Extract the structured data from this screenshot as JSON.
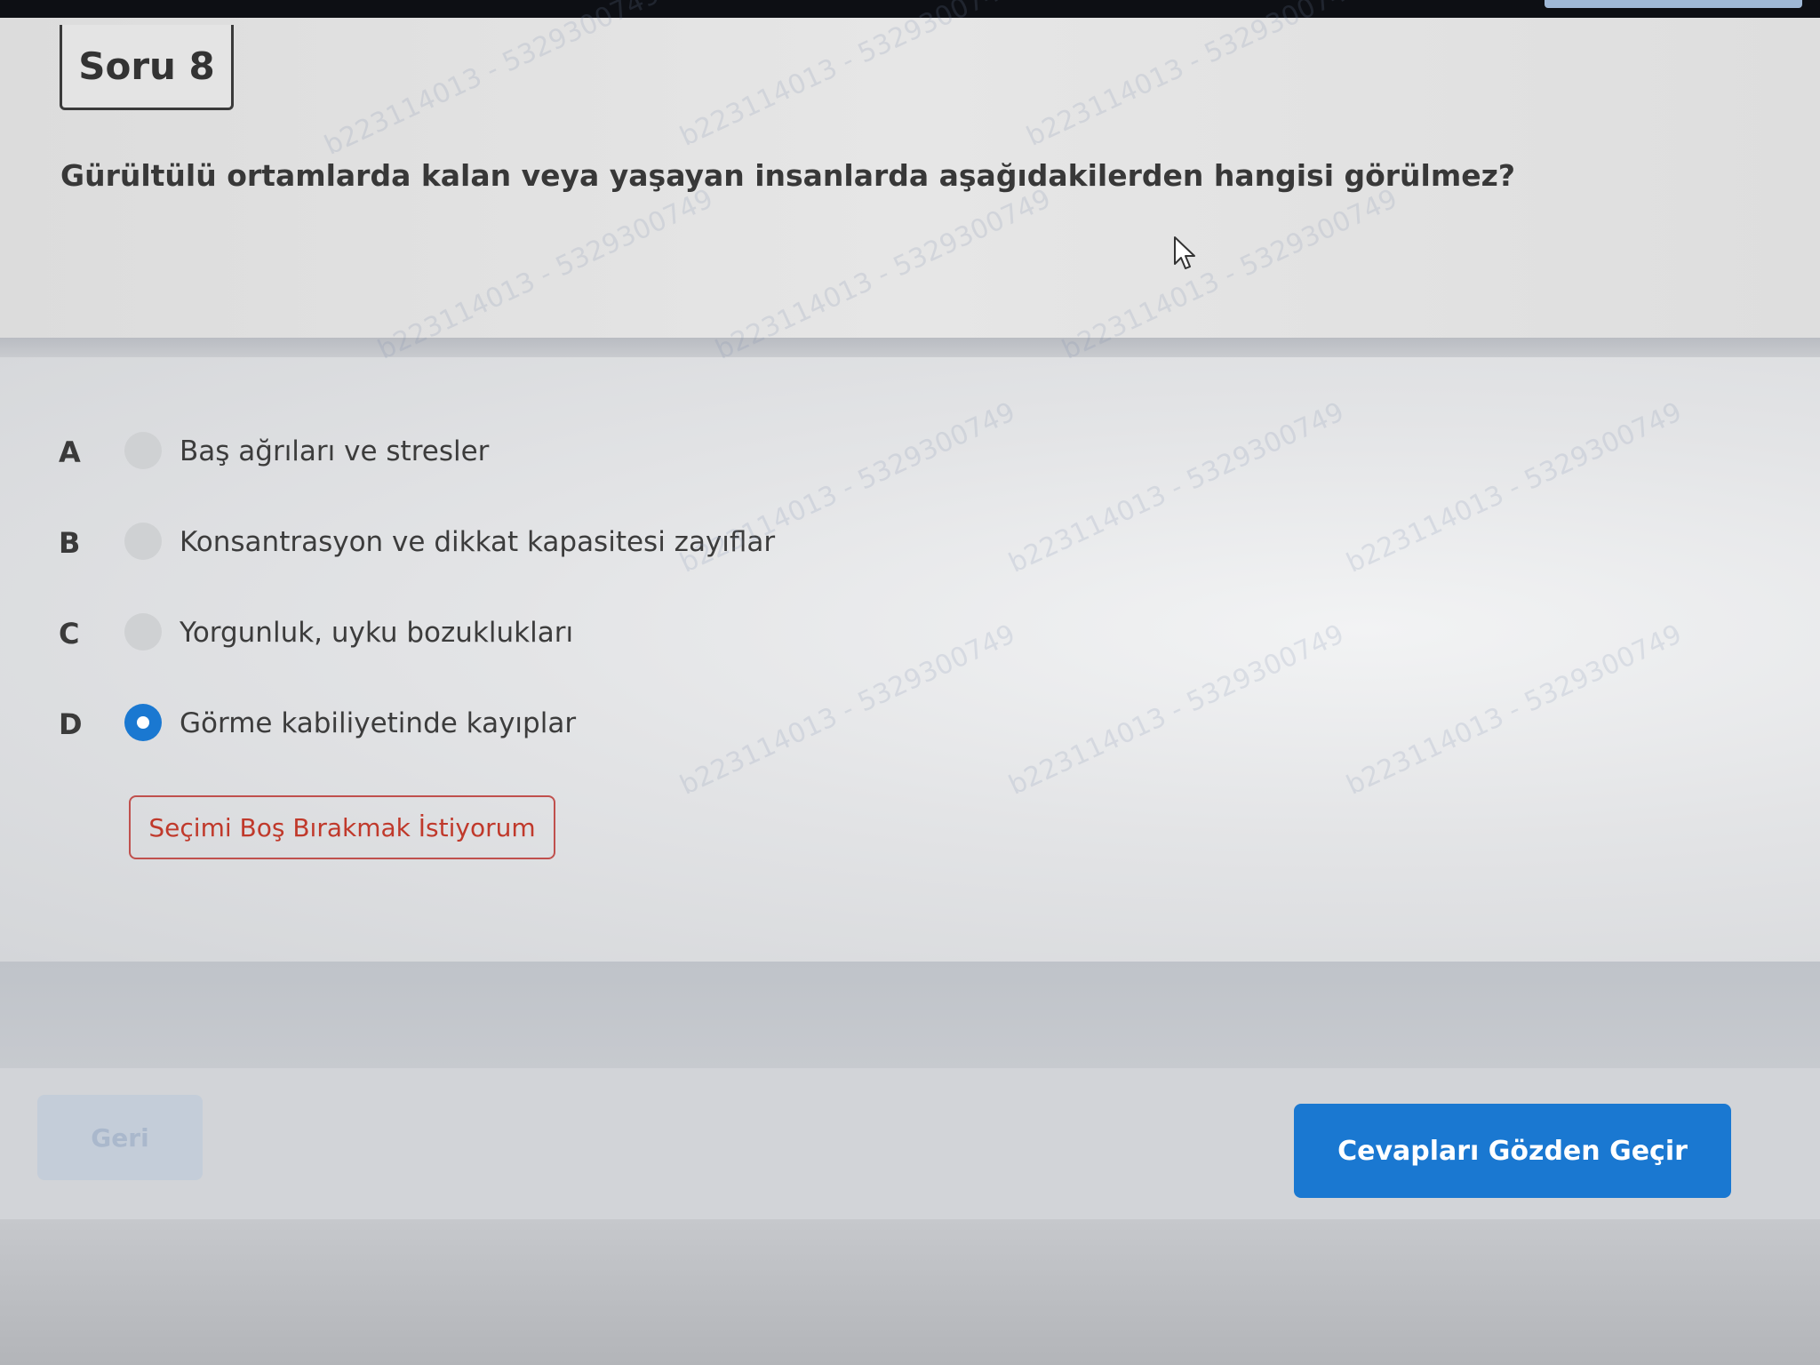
{
  "question": {
    "title": "Soru 8",
    "text": "Gürültülü ortamlarda kalan veya yaşayan insanlarda aşağıdakilerden hangisi görülmez?"
  },
  "options": [
    {
      "letter": "A",
      "label": "Baş ağrıları ve stresler",
      "selected": false
    },
    {
      "letter": "B",
      "label": "Konsantrasyon ve dikkat kapasitesi zayıflar",
      "selected": false
    },
    {
      "letter": "C",
      "label": "Yorgunluk, uyku bozuklukları",
      "selected": false
    },
    {
      "letter": "D",
      "label": "Görme kabiliyetinde kayıplar",
      "selected": true
    }
  ],
  "skip_button": {
    "label": "Seçimi Boş Bırakmak İstiyorum"
  },
  "nav": {
    "back_label": "Geri",
    "review_label": "Cevapları Gözden Geçir"
  },
  "watermark": {
    "text": "b223114013 - 5329300749"
  },
  "colors": {
    "accent": "#1a78d1",
    "skip_border": "#c0504d",
    "skip_text": "#c0392b",
    "back_bg": "#c4cdd9"
  },
  "icons": {
    "cursor": "mouse-pointer-icon",
    "selected_radio": "radio-selected-icon",
    "unselected_radio": "radio-empty-icon"
  }
}
